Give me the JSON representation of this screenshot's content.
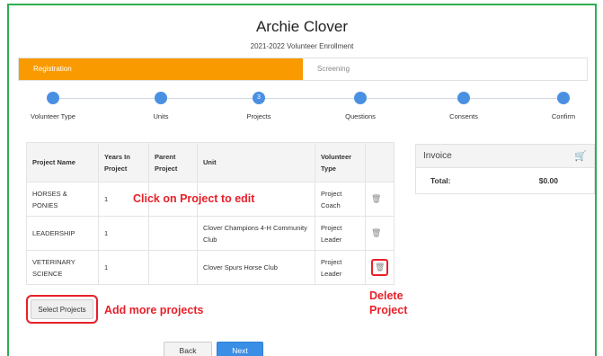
{
  "header": {
    "name": "Archie Clover",
    "subtitle": "2021-2022 Volunteer Enrollment"
  },
  "tabs": {
    "registration": "Registration",
    "screening": "Screening"
  },
  "steps": [
    {
      "label": "Volunteer Type",
      "marker": ""
    },
    {
      "label": "Units",
      "marker": ""
    },
    {
      "label": "Projects",
      "marker": "3"
    },
    {
      "label": "Questions",
      "marker": ""
    },
    {
      "label": "Consents",
      "marker": ""
    },
    {
      "label": "Confirm",
      "marker": ""
    }
  ],
  "table": {
    "headers": {
      "project_name": "Project Name",
      "years_in_project": "Years In Project",
      "parent_project": "Parent Project",
      "unit": "Unit",
      "volunteer_type": "Volunteer Type"
    },
    "rows": [
      {
        "project": "HORSES & PONIES",
        "years": "1",
        "parent": "",
        "unit": "",
        "type": "Project Coach"
      },
      {
        "project": "LEADERSHIP",
        "years": "1",
        "parent": "",
        "unit": "Clover Champions 4-H Community Club",
        "type": "Project Leader"
      },
      {
        "project": "VETERINARY SCIENCE",
        "years": "1",
        "parent": "",
        "unit": "Clover Spurs Horse Club",
        "type": "Project Leader"
      }
    ]
  },
  "invoice": {
    "title": "Invoice",
    "total_label": "Total:",
    "total_value": "$0.00",
    "cart_icon": "cart-icon"
  },
  "buttons": {
    "select_projects": "Select Projects",
    "back": "Back",
    "next": "Next"
  },
  "annotations": {
    "click_edit": "Click on Project to edit",
    "add_more": "Add more projects",
    "delete_line1": "Delete",
    "delete_line2": "Project"
  },
  "colors": {
    "accent_orange": "#f89a00",
    "step_blue": "#4a90e2",
    "next_blue": "#3a8ee6",
    "annotation_red": "#e8202a",
    "frame_green": "#2eae4f"
  }
}
